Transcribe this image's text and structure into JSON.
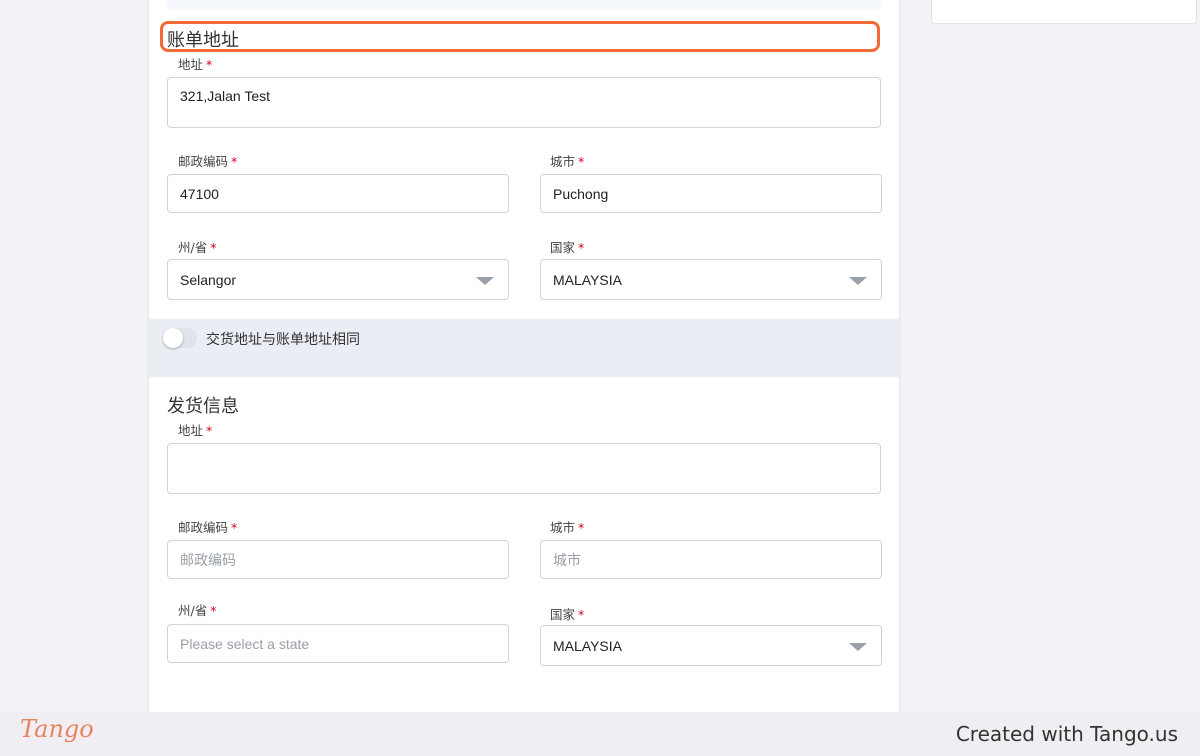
{
  "billing": {
    "title": "账单地址",
    "address_label": "地址",
    "address_value": "321,Jalan Test",
    "postcode_label": "邮政编码",
    "postcode_value": "47100",
    "city_label": "城市",
    "city_value": "Puchong",
    "state_label": "州/省",
    "state_value": "Selangor",
    "country_label": "国家",
    "country_value": "MALAYSIA"
  },
  "same_address_toggle": {
    "label": "交货地址与账单地址相同",
    "state": "off"
  },
  "shipping": {
    "title": "发货信息",
    "address_label": "地址",
    "address_value": "",
    "postcode_label": "邮政编码",
    "postcode_placeholder": "邮政编码",
    "city_label": "城市",
    "city_placeholder": "城市",
    "state_label": "州/省",
    "state_placeholder": "Please select a state",
    "country_label": "国家",
    "country_value": "MALAYSIA"
  },
  "required_mark": "*",
  "footer": {
    "logo": "Tango",
    "text": "Created with Tango.us"
  },
  "colors": {
    "highlight": "#f26a35",
    "required": "#d0021b",
    "logo": "#e8855f"
  }
}
